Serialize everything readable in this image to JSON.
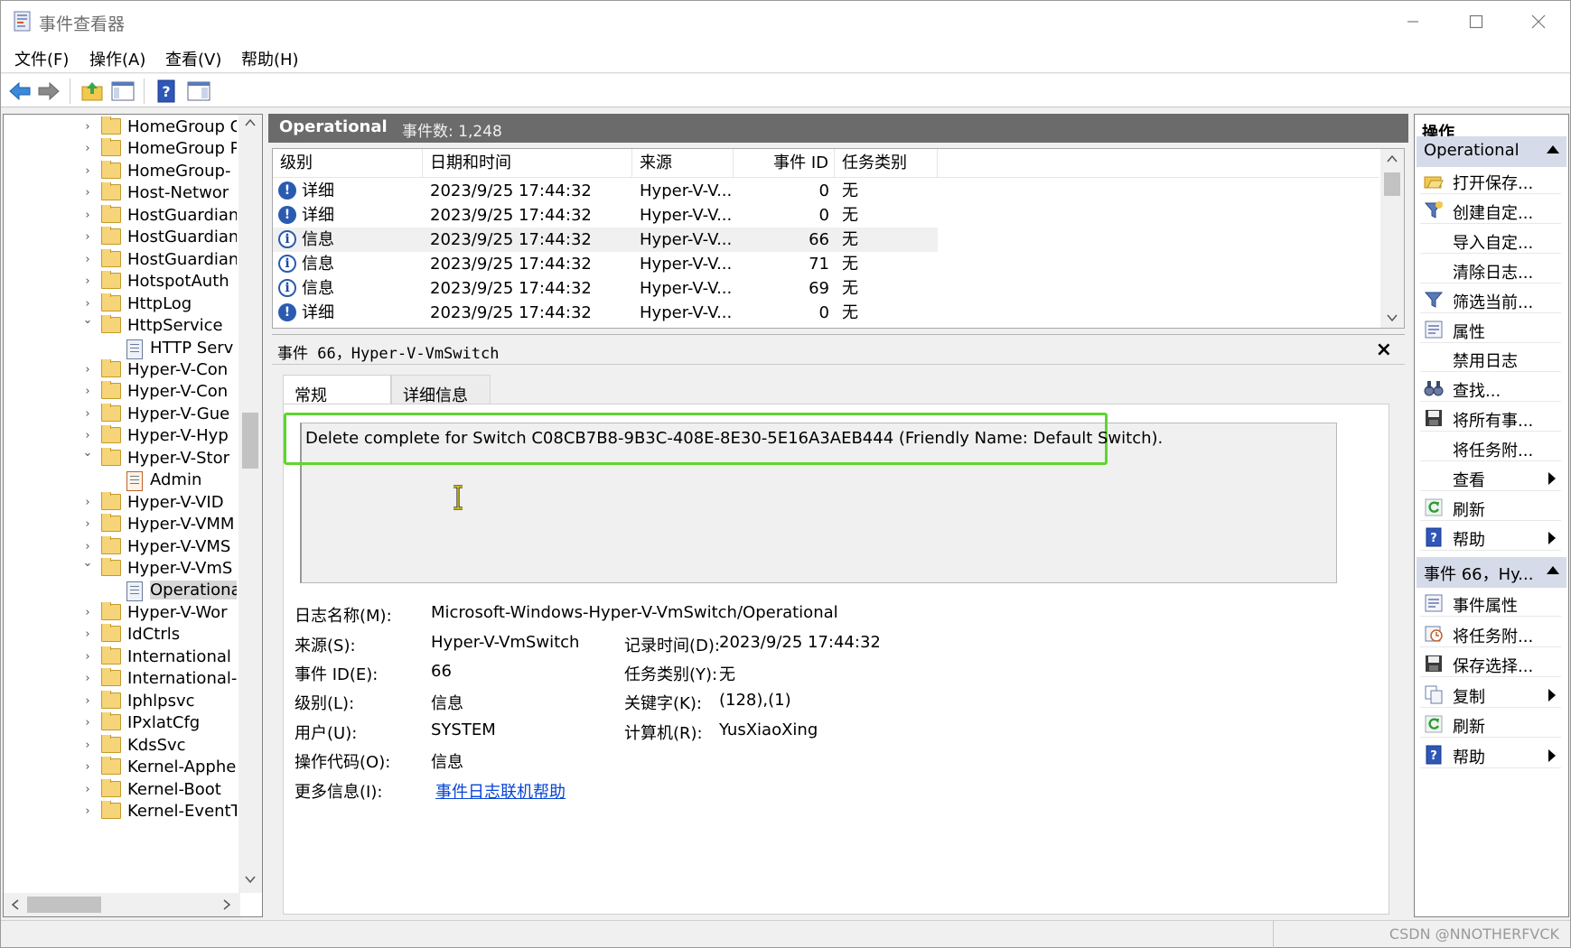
{
  "window": {
    "title": "事件查看器"
  },
  "menu": [
    "文件(F)",
    "操作(A)",
    "查看(V)",
    "帮助(H)"
  ],
  "tree": {
    "items": [
      {
        "label": "HomeGroup C",
        "kind": "folder",
        "state": "collapsed",
        "level": 1
      },
      {
        "label": "HomeGroup P",
        "kind": "folder",
        "state": "collapsed",
        "level": 1
      },
      {
        "label": "HomeGroup-",
        "kind": "folder",
        "state": "collapsed",
        "level": 1
      },
      {
        "label": "Host-Networ",
        "kind": "folder",
        "state": "collapsed",
        "level": 1
      },
      {
        "label": "HostGuardian",
        "kind": "folder",
        "state": "collapsed",
        "level": 1
      },
      {
        "label": "HostGuardian",
        "kind": "folder",
        "state": "collapsed",
        "level": 1
      },
      {
        "label": "HostGuardian",
        "kind": "folder",
        "state": "collapsed",
        "level": 1
      },
      {
        "label": "HotspotAuth",
        "kind": "folder",
        "state": "collapsed",
        "level": 1
      },
      {
        "label": "HttpLog",
        "kind": "folder",
        "state": "collapsed",
        "level": 1
      },
      {
        "label": "HttpService",
        "kind": "folder",
        "state": "expanded",
        "level": 1
      },
      {
        "label": "HTTP Serv",
        "kind": "log",
        "state": "none",
        "level": 2
      },
      {
        "label": "Hyper-V-Con",
        "kind": "folder",
        "state": "collapsed",
        "level": 1
      },
      {
        "label": "Hyper-V-Con",
        "kind": "folder",
        "state": "collapsed",
        "level": 1
      },
      {
        "label": "Hyper-V-Gue",
        "kind": "folder",
        "state": "collapsed",
        "level": 1
      },
      {
        "label": "Hyper-V-Hyp",
        "kind": "folder",
        "state": "collapsed",
        "level": 1
      },
      {
        "label": "Hyper-V-Stor",
        "kind": "folder",
        "state": "expanded",
        "level": 1
      },
      {
        "label": "Admin",
        "kind": "admin-log",
        "state": "none",
        "level": 2
      },
      {
        "label": "Hyper-V-VID",
        "kind": "folder",
        "state": "collapsed",
        "level": 1
      },
      {
        "label": "Hyper-V-VMM",
        "kind": "folder",
        "state": "collapsed",
        "level": 1
      },
      {
        "label": "Hyper-V-VMS",
        "kind": "folder",
        "state": "collapsed",
        "level": 1
      },
      {
        "label": "Hyper-V-VmS",
        "kind": "folder",
        "state": "expanded",
        "level": 1
      },
      {
        "label": "Operational",
        "kind": "log",
        "state": "none",
        "level": 2,
        "selected": true
      },
      {
        "label": "Hyper-V-Wor",
        "kind": "folder",
        "state": "collapsed",
        "level": 1
      },
      {
        "label": "IdCtrls",
        "kind": "folder",
        "state": "collapsed",
        "level": 1
      },
      {
        "label": "International",
        "kind": "folder",
        "state": "collapsed",
        "level": 1
      },
      {
        "label": "International-",
        "kind": "folder",
        "state": "collapsed",
        "level": 1
      },
      {
        "label": "Iphlpsvc",
        "kind": "folder",
        "state": "collapsed",
        "level": 1
      },
      {
        "label": "IPxlatCfg",
        "kind": "folder",
        "state": "collapsed",
        "level": 1
      },
      {
        "label": "KdsSvc",
        "kind": "folder",
        "state": "collapsed",
        "level": 1
      },
      {
        "label": "Kernel-Apphe",
        "kind": "folder",
        "state": "collapsed",
        "level": 1
      },
      {
        "label": "Kernel-Boot",
        "kind": "folder",
        "state": "collapsed",
        "level": 1
      },
      {
        "label": "Kernel-EventT",
        "kind": "folder",
        "state": "collapsed",
        "level": 1
      }
    ]
  },
  "log_header": {
    "name": "Operational",
    "count_text": "事件数: 1,248"
  },
  "events": {
    "columns": [
      "级别",
      "日期和时间",
      "来源",
      "事件 ID",
      "任务类别"
    ],
    "rows": [
      {
        "level_icon": "verbose-icon",
        "level": "详细",
        "datetime": "2023/9/25 17:44:32",
        "source": "Hyper-V-V...",
        "id": "0",
        "task": "无",
        "selected": false
      },
      {
        "level_icon": "verbose-icon",
        "level": "详细",
        "datetime": "2023/9/25 17:44:32",
        "source": "Hyper-V-V...",
        "id": "0",
        "task": "无",
        "selected": false
      },
      {
        "level_icon": "info-icon",
        "level": "信息",
        "datetime": "2023/9/25 17:44:32",
        "source": "Hyper-V-V...",
        "id": "66",
        "task": "无",
        "selected": true
      },
      {
        "level_icon": "info-icon",
        "level": "信息",
        "datetime": "2023/9/25 17:44:32",
        "source": "Hyper-V-V...",
        "id": "71",
        "task": "无",
        "selected": false
      },
      {
        "level_icon": "info-icon",
        "level": "信息",
        "datetime": "2023/9/25 17:44:32",
        "source": "Hyper-V-V...",
        "id": "69",
        "task": "无",
        "selected": false
      },
      {
        "level_icon": "verbose-icon",
        "level": "详细",
        "datetime": "2023/9/25 17:44:32",
        "source": "Hyper-V-V...",
        "id": "0",
        "task": "无",
        "selected": false
      }
    ]
  },
  "detail": {
    "title": "事件 66，Hyper-V-VmSwitch",
    "tabs": [
      "常规",
      "详细信息"
    ],
    "message": "Delete complete for Switch C08CB7B8-9B3C-408E-8E30-5E16A3AEB444 (Friendly Name: Default Switch).",
    "fields": {
      "log_name_label": "日志名称(M):",
      "log_name": "Microsoft-Windows-Hyper-V-VmSwitch/Operational",
      "source_label": "来源(S):",
      "source": "Hyper-V-VmSwitch",
      "logged_label": "记录时间(D):",
      "logged": "2023/9/25 17:44:32",
      "event_id_label": "事件 ID(E):",
      "event_id": "66",
      "task_label": "任务类别(Y):",
      "task": "无",
      "level_label": "级别(L):",
      "level": "信息",
      "keywords_label": "关键字(K):",
      "keywords": "(128),(1)",
      "user_label": "用户(U):",
      "user": "SYSTEM",
      "computer_label": "计算机(R):",
      "computer": "YusXiaoXing",
      "opcode_label": "操作代码(O):",
      "opcode": "信息",
      "more_label": "更多信息(I):",
      "more_link": "事件日志联机帮助"
    }
  },
  "actions": {
    "title": "操作",
    "group1": {
      "label": "Operational",
      "items": [
        {
          "label": "打开保存...",
          "icon": "open-folder-icon",
          "submenu": false
        },
        {
          "label": "创建自定...",
          "icon": "filter-create-icon",
          "submenu": false
        },
        {
          "label": "导入自定...",
          "icon": "",
          "submenu": false
        },
        {
          "label": "清除日志...",
          "icon": "",
          "submenu": false
        },
        {
          "label": "筛选当前...",
          "icon": "filter-icon",
          "submenu": false
        },
        {
          "label": "属性",
          "icon": "properties-icon",
          "submenu": false
        },
        {
          "label": "禁用日志",
          "icon": "",
          "submenu": false
        },
        {
          "label": "查找...",
          "icon": "binoculars-icon",
          "submenu": false
        },
        {
          "label": "将所有事...",
          "icon": "save-icon",
          "submenu": false
        },
        {
          "label": "将任务附...",
          "icon": "",
          "submenu": false
        },
        {
          "label": "查看",
          "icon": "",
          "submenu": true
        },
        {
          "label": "刷新",
          "icon": "refresh-icon",
          "submenu": false
        },
        {
          "label": "帮助",
          "icon": "help-icon",
          "submenu": true
        }
      ]
    },
    "group2": {
      "label": "事件 66，Hy...",
      "items": [
        {
          "label": "事件属性",
          "icon": "properties-icon",
          "submenu": false
        },
        {
          "label": "将任务附...",
          "icon": "task-clock-icon",
          "submenu": false
        },
        {
          "label": "保存选择...",
          "icon": "save-icon",
          "submenu": false
        },
        {
          "label": "复制",
          "icon": "copy-icon",
          "submenu": true
        },
        {
          "label": "刷新",
          "icon": "refresh-icon",
          "submenu": false
        },
        {
          "label": "帮助",
          "icon": "help-icon",
          "submenu": true
        }
      ]
    }
  },
  "status": {
    "watermark": "CSDN @NNOTHERFVCK"
  },
  "colors": {
    "highlight": "#5ed52f",
    "header_bar": "#6b6b6b",
    "group_bg": "#d6dbe9",
    "link": "#0645d6",
    "info_blue": "#2a5bb0"
  }
}
